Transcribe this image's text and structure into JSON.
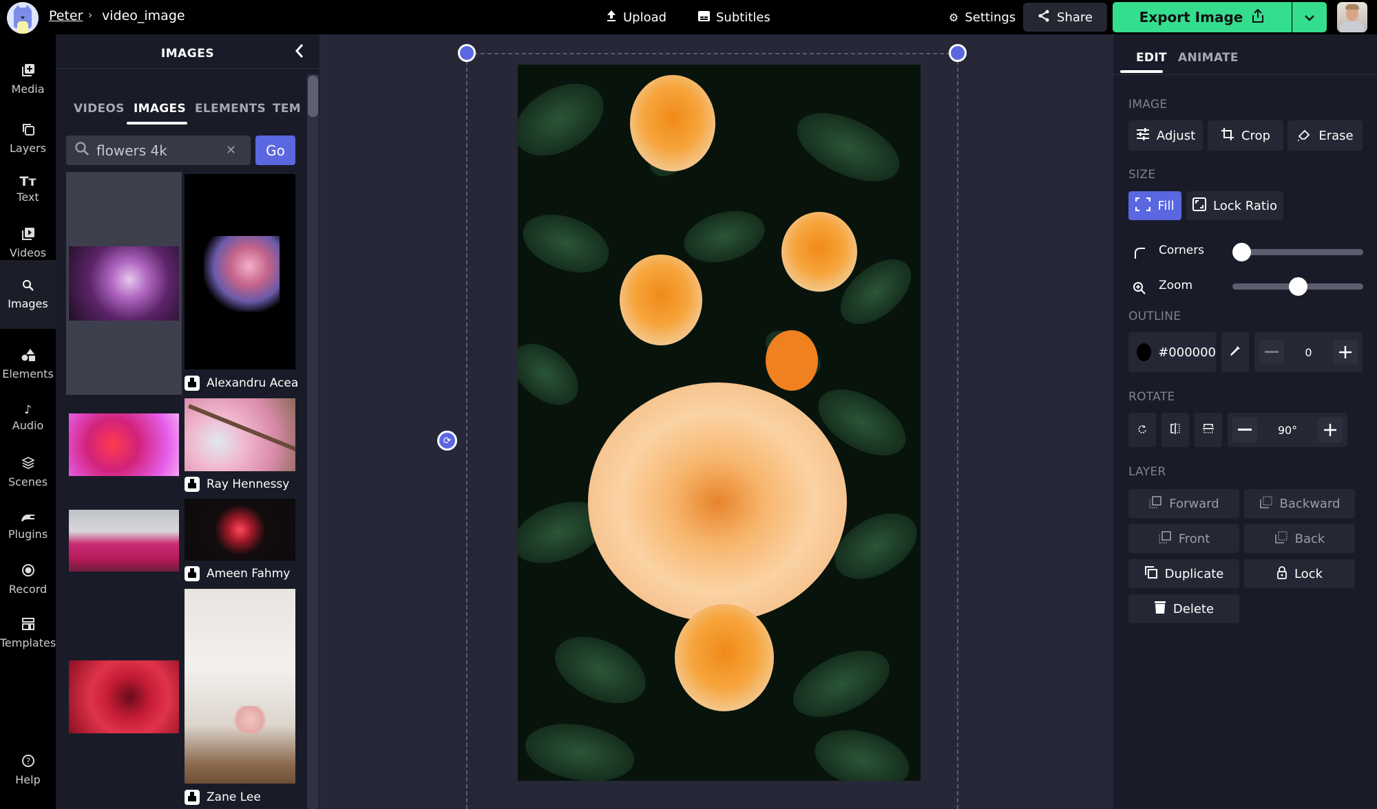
{
  "header": {
    "user": "Peter",
    "separator": "›",
    "project": "video_image",
    "upload": "Upload",
    "subtitles": "Subtitles",
    "settings": "Settings",
    "share": "Share",
    "export": "Export Image",
    "brand_color": "#34de8e",
    "accent_color": "#5a67e0"
  },
  "nav": {
    "items": [
      {
        "label": "Media",
        "icon": "media-add-icon"
      },
      {
        "label": "Layers",
        "icon": "layers-icon"
      },
      {
        "label": "Text",
        "icon": "text-icon"
      },
      {
        "label": "Videos",
        "icon": "video-icon"
      },
      {
        "label": "Images",
        "icon": "search-icon",
        "active": true
      },
      {
        "label": "Elements",
        "icon": "shapes-icon"
      },
      {
        "label": "Audio",
        "icon": "music-note-icon"
      },
      {
        "label": "Scenes",
        "icon": "stack-icon"
      },
      {
        "label": "Plugins",
        "icon": "plug-icon"
      },
      {
        "label": "Record",
        "icon": "record-icon"
      },
      {
        "label": "Templates",
        "icon": "templates-icon"
      }
    ],
    "help": "Help"
  },
  "panel": {
    "title": "IMAGES",
    "tabs": [
      "VIDEOS",
      "IMAGES",
      "ELEMENTS",
      "TEM"
    ],
    "active_tab": "IMAGES",
    "search": {
      "value": "flowers 4k",
      "placeholder": "Search",
      "go": "Go"
    },
    "results": [
      {
        "credit": ""
      },
      {
        "credit": "Alexandru Acea"
      },
      {
        "credit": ""
      },
      {
        "credit": "Ray Hennessy"
      },
      {
        "credit": ""
      },
      {
        "credit": "Ameen Fahmy"
      },
      {
        "credit": ""
      },
      {
        "credit": "Zane Lee"
      }
    ]
  },
  "right_panel": {
    "tabs": [
      "EDIT",
      "ANIMATE"
    ],
    "active_tab": "EDIT",
    "image_section": "IMAGE",
    "adjust": "Adjust",
    "crop": "Crop",
    "erase": "Erase",
    "size_section": "SIZE",
    "fill": "Fill",
    "lock_ratio": "Lock Ratio",
    "corners": {
      "label": "Corners",
      "value_fraction": 0.0
    },
    "zoom": {
      "label": "Zoom",
      "value_fraction": 0.5
    },
    "outline_section": "OUTLINE",
    "outline_color": "#000000",
    "outline_width": "0",
    "rotate_section": "ROTATE",
    "rotate_value": "90°",
    "layer_section": "LAYER",
    "forward": "Forward",
    "backward": "Backward",
    "front": "Front",
    "back": "Back",
    "duplicate": "Duplicate",
    "lock": "Lock",
    "delete": "Delete"
  }
}
